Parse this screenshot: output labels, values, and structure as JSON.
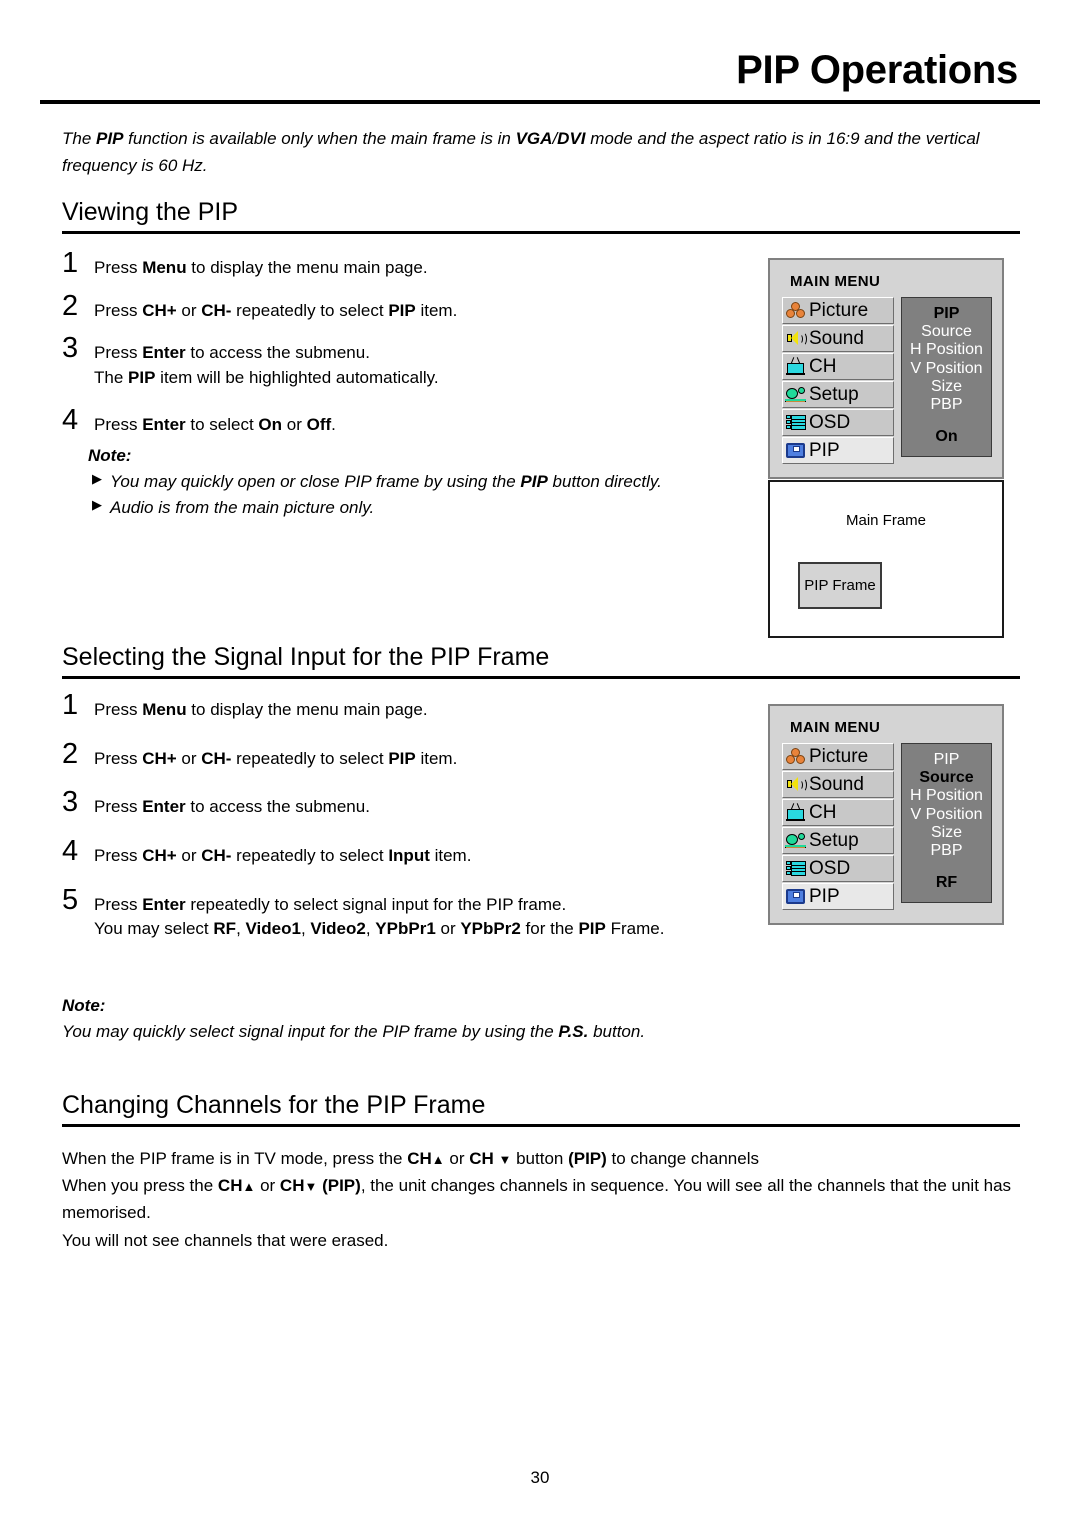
{
  "document": {
    "title": "PIP Operations",
    "page_number": "30",
    "intro": {
      "prefix": "The ",
      "b1": "PIP",
      "mid1": " function is available only when the main frame is in ",
      "b2": "VGA",
      "mid2": "/",
      "b3": "DVI",
      "suffix": " mode and the aspect ratio is in 16:9 and the vertical frequency is 60 Hz."
    }
  },
  "sections": [
    {
      "heading": "Viewing the PIP",
      "steps": [
        {
          "num": "1",
          "parts": [
            "Press ",
            "Menu",
            " to display the menu main page."
          ]
        },
        {
          "num": "2",
          "parts": [
            "Press ",
            "CH+",
            " or ",
            "CH-",
            " repeatedly to select ",
            "PIP",
            " item."
          ]
        },
        {
          "num": "3",
          "line1_a": "Press ",
          "line1_b": "Enter",
          "line1_c": " to access the submenu.",
          "line2_a": "The ",
          "line2_b": "PIP",
          "line2_c": " item will be highlighted automatically."
        },
        {
          "num": "4",
          "parts": [
            "Press ",
            "Enter",
            " to select ",
            "On",
            " or ",
            "Off",
            "."
          ]
        }
      ],
      "note": {
        "title": "Note:",
        "bullets": [
          {
            "a": "You may quickly open or close PIP frame by using the ",
            "b": "PIP",
            "c": " button directly."
          },
          {
            "a": "Audio is from the main picture only.",
            "b": "",
            "c": ""
          }
        ]
      }
    },
    {
      "heading": "Selecting the Signal Input for the PIP Frame",
      "steps": [
        {
          "num": "1"
        },
        {
          "num": "2"
        },
        {
          "num": "3"
        },
        {
          "num": "4"
        },
        {
          "num": "5"
        }
      ]
    },
    {
      "heading": "Changing Channels for the PIP Frame"
    }
  ],
  "section2": {
    "heading": "Selecting the Signal Input for the PIP Frame",
    "step1": {
      "num": "1",
      "a": "Press ",
      "b": "Menu",
      "c": " to display the menu main page."
    },
    "step2": {
      "num": "2",
      "a": "Press ",
      "b": "CH+",
      "c": " or ",
      "d": "CH-",
      "e": " repeatedly to select ",
      "f": "PIP",
      "g": " item."
    },
    "step3": {
      "num": "3",
      "a": "Press ",
      "b": "Enter",
      "c": " to access the submenu."
    },
    "step4": {
      "num": "4",
      "a": "Press ",
      "b": "CH+",
      "c": " or ",
      "d": "CH-",
      "e": " repeatedly to select ",
      "f": "Input",
      "g": " item."
    },
    "step5": {
      "num": "5",
      "l1a": "Press ",
      "l1b": "Enter",
      "l1c": " repeatedly to select signal input for the PIP frame.",
      "l2a": "You may select ",
      "l2b": "RF",
      "l2c": ", ",
      "l2d": "Video1",
      "l2e": ", ",
      "l2f": "Video2",
      "l2g": ", ",
      "l2h": "YPbPr1",
      "l2i": " or ",
      "l2j": "YPbPr2",
      "l2k": " for the ",
      "l2l": "PIP",
      "l2m": " Frame."
    },
    "note": {
      "title": "Note:",
      "a": "You may quickly select signal input for the PIP frame by using the ",
      "b": "P.S.",
      "c": " button."
    }
  },
  "section3": {
    "heading": "Changing Channels for the PIP Frame",
    "line1": {
      "a": "When the PIP frame is in TV mode, press the ",
      "b": "CH",
      "arrow_up": "▲",
      "c": " or ",
      "d": "CH ",
      "arrow_down": "▼",
      "e": " button ",
      "f": "(PIP)",
      "g": " to change channels"
    },
    "line2": {
      "a": "When you press the ",
      "b": "CH",
      "arrow_up": "▲",
      "c": " or ",
      "d": "CH",
      "arrow_down": "▼",
      "e": " (PIP)",
      "f": ", the unit changes channels in sequence. You will see all the channels that the unit has memorised."
    },
    "line3": "You will not see channels that were erased."
  },
  "osd_menu_1": {
    "title": "MAIN MENU",
    "items": [
      {
        "label": "Picture",
        "icon": "picture-icon",
        "selected": false
      },
      {
        "label": "Sound",
        "icon": "sound-icon",
        "selected": false
      },
      {
        "label": "CH",
        "icon": "ch-icon",
        "selected": false
      },
      {
        "label": "Setup",
        "icon": "setup-icon",
        "selected": false
      },
      {
        "label": "OSD",
        "icon": "osd-icon",
        "selected": false
      },
      {
        "label": "PIP",
        "icon": "pip-icon",
        "selected": true
      }
    ],
    "submenu": [
      {
        "label": "PIP",
        "highlighted": true
      },
      {
        "label": "Source",
        "highlighted": false
      },
      {
        "label": "H Position",
        "highlighted": false
      },
      {
        "label": "V Position",
        "highlighted": false
      },
      {
        "label": "Size",
        "highlighted": false
      },
      {
        "label": "PBP",
        "highlighted": false
      }
    ],
    "value": "On"
  },
  "osd_menu_2": {
    "title": "MAIN MENU",
    "items": [
      {
        "label": "Picture",
        "icon": "picture-icon",
        "selected": false
      },
      {
        "label": "Sound",
        "icon": "sound-icon",
        "selected": false
      },
      {
        "label": "CH",
        "icon": "ch-icon",
        "selected": false
      },
      {
        "label": "Setup",
        "icon": "setup-icon",
        "selected": false
      },
      {
        "label": "OSD",
        "icon": "osd-icon",
        "selected": false
      },
      {
        "label": "PIP",
        "icon": "pip-icon",
        "selected": true
      }
    ],
    "submenu": [
      {
        "label": "PIP",
        "highlighted": false
      },
      {
        "label": "Source",
        "highlighted": true
      },
      {
        "label": "H Position",
        "highlighted": false
      },
      {
        "label": "V Position",
        "highlighted": false
      },
      {
        "label": "Size",
        "highlighted": false
      },
      {
        "label": "PBP",
        "highlighted": false
      }
    ],
    "value": "RF"
  },
  "frame_diagram": {
    "main_label": "Main Frame",
    "pip_label": "PIP Frame"
  },
  "colors": {
    "menu_bg": "#d4d4d4",
    "submenu_bg": "#808080",
    "item_bg": "#c8c8c8",
    "item_selected_bg": "#e8e8e8",
    "picture_icon": "#e8833a",
    "sound_icon": "#f2e20c",
    "ch_icon": "#2ad8e0",
    "setup_icon": "#21d99a",
    "osd_icon": "#2ad8e0",
    "pip_icon": "#4f7fe0"
  }
}
